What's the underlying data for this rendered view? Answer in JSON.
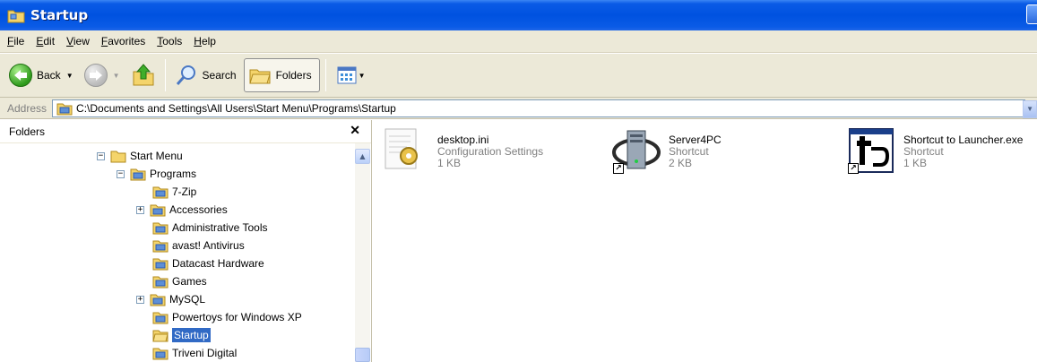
{
  "window": {
    "title": "Startup"
  },
  "menu": [
    "File",
    "Edit",
    "View",
    "Favorites",
    "Tools",
    "Help"
  ],
  "toolbar": {
    "back_label": "Back",
    "search_label": "Search",
    "folders_label": "Folders"
  },
  "address": {
    "label": "Address",
    "value": "C:\\Documents and Settings\\All Users\\Start Menu\\Programs\\Startup"
  },
  "folders_pane": {
    "title": "Folders",
    "tree": [
      {
        "label": "Start Menu",
        "expander": "−",
        "level": 0
      },
      {
        "label": "Programs",
        "expander": "−",
        "level": 1
      },
      {
        "label": "7-Zip",
        "expander": "",
        "level": 2
      },
      {
        "label": "Accessories",
        "expander": "+",
        "level": 2
      },
      {
        "label": "Administrative Tools",
        "expander": "",
        "level": 2
      },
      {
        "label": "avast! Antivirus",
        "expander": "",
        "level": 2
      },
      {
        "label": "Datacast Hardware",
        "expander": "",
        "level": 2
      },
      {
        "label": "Games",
        "expander": "",
        "level": 2
      },
      {
        "label": "MySQL",
        "expander": "+",
        "level": 2
      },
      {
        "label": "Powertoys for Windows XP",
        "expander": "",
        "level": 2
      },
      {
        "label": "Startup",
        "expander": "",
        "level": 2,
        "selected": true
      },
      {
        "label": "Triveni Digital",
        "expander": "",
        "level": 2
      }
    ]
  },
  "files": [
    {
      "name": "desktop.ini",
      "type": "Configuration Settings",
      "size": "1 KB",
      "icon": "config-settings-icon"
    },
    {
      "name": "Server4PC",
      "type": "Shortcut",
      "size": "2 KB",
      "icon": "server-shortcut-icon"
    },
    {
      "name": "Shortcut to Launcher.exe",
      "type": "Shortcut",
      "size": "1 KB",
      "icon": "launcher-shortcut-icon"
    }
  ],
  "colors": {
    "titlebar": "#0052e0",
    "chrome": "#ece9d8",
    "selection": "#316ac5"
  }
}
